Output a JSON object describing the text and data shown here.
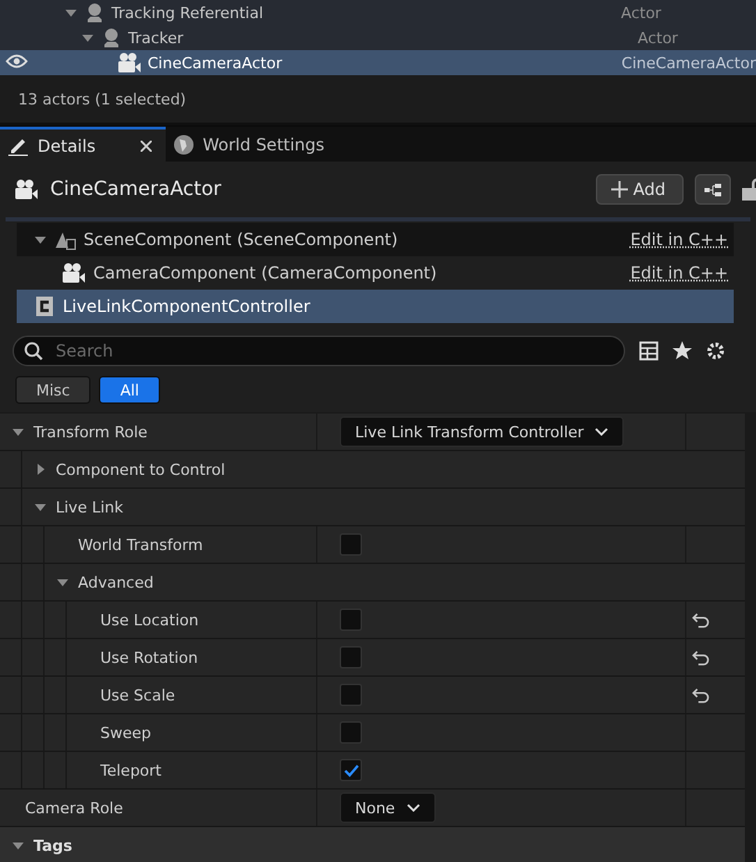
{
  "outliner": {
    "rows": [
      {
        "label": "Tracking Referential",
        "type": "Actor",
        "expanded": true,
        "visible": false,
        "selected": false,
        "kind": "actor",
        "children": [
          {
            "label": "Tracker",
            "type": "Actor",
            "expanded": true,
            "visible": false,
            "selected": false,
            "kind": "actor",
            "children": [
              {
                "label": "CineCameraActor",
                "type": "CineCameraActor",
                "visible": true,
                "selected": true,
                "kind": "camera"
              }
            ]
          }
        ]
      }
    ],
    "status": "13 actors (1 selected)"
  },
  "tabs": [
    {
      "label": "Details",
      "selected": true,
      "closable": true,
      "kind": "pencil"
    },
    {
      "label": "World Settings",
      "selected": false,
      "closable": false,
      "kind": "globe"
    }
  ],
  "header": {
    "title": "CineCameraActor",
    "add_button": "Add"
  },
  "components": [
    {
      "label": "SceneComponent (SceneComponent)",
      "link": "Edit in C++",
      "selected": false,
      "expanded": true,
      "kind": "scene",
      "children": [
        {
          "label": "CameraComponent (CameraComponent)",
          "link": "Edit in C++",
          "selected": false,
          "kind": "camera"
        }
      ]
    },
    {
      "label": "LiveLinkComponentController",
      "selected": true,
      "kind": "cpp"
    }
  ],
  "search": {
    "placeholder": "Search"
  },
  "filters": [
    {
      "label": "Misc",
      "selected": false
    },
    {
      "label": "All",
      "selected": true
    }
  ],
  "properties": [
    {
      "kind": "dropdown",
      "label": "Transform Role",
      "value": "Live Link Transform Controller",
      "expanded": true,
      "children": [
        {
          "kind": "group",
          "label": "Component to Control",
          "expanded": false
        },
        {
          "kind": "group",
          "label": "Live Link",
          "expanded": true,
          "children": [
            {
              "kind": "checkbox",
              "label": "World Transform",
              "checked": false,
              "resettable": false
            },
            {
              "kind": "group",
              "label": "Advanced",
              "expanded": true,
              "children": [
                {
                  "kind": "checkbox",
                  "label": "Use Location",
                  "checked": false,
                  "resettable": true
                },
                {
                  "kind": "checkbox",
                  "label": "Use Rotation",
                  "checked": false,
                  "resettable": true
                },
                {
                  "kind": "checkbox",
                  "label": "Use Scale",
                  "checked": false,
                  "resettable": true
                },
                {
                  "kind": "checkbox",
                  "label": "Sweep",
                  "checked": false,
                  "resettable": false
                },
                {
                  "kind": "checkbox",
                  "label": "Teleport",
                  "checked": true,
                  "resettable": false
                }
              ]
            }
          ]
        }
      ]
    },
    {
      "kind": "dropdown",
      "label": "Camera Role",
      "value": "None"
    },
    {
      "kind": "category",
      "label": "Tags",
      "expanded": true
    }
  ]
}
